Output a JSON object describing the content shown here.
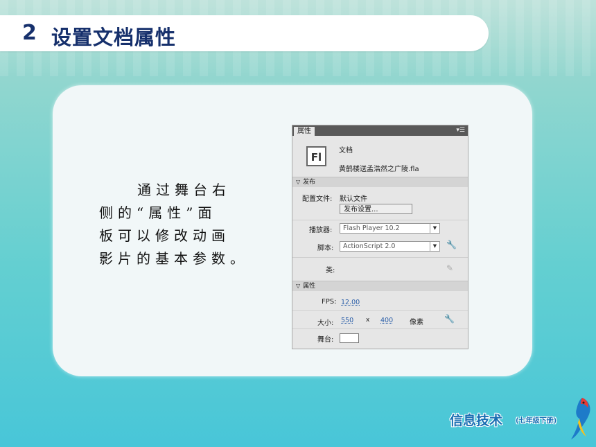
{
  "slide": {
    "number": "2",
    "title": "设置文档属性",
    "description_lines": [
      "通过舞台右",
      "侧的“属性”面",
      "板可以修改动画",
      "影片的基本参数。"
    ]
  },
  "panel": {
    "tab": "属性",
    "menu_icon": "panel-menu-icon",
    "doc_icon_text": "Fl",
    "doc_type": "文档",
    "doc_name": "黄鹤楼送孟浩然之广陵.fla",
    "publish_section": "发布",
    "profile_label": "配置文件:",
    "profile_value": "默认文件",
    "publish_settings_button": "发布设置...",
    "player_label": "播放器:",
    "player_value": "Flash Player 10.2",
    "script_label": "脚本:",
    "script_value": "ActionScript 2.0",
    "class_label": "类:",
    "properties_section": "属性",
    "fps_label": "FPS:",
    "fps_value": "12.00",
    "size_label": "大小:",
    "width_value": "550",
    "x_sep": "x",
    "height_value": "400",
    "unit": "像素",
    "stage_label": "舞台:",
    "stage_color": "#ffffff"
  },
  "footer": {
    "logo_text": "信息技术",
    "logo_sub": "(七年级下册)"
  },
  "colors": {
    "title": "#16306c",
    "link": "#2a5ea8",
    "logo": "#1a6fb3"
  }
}
